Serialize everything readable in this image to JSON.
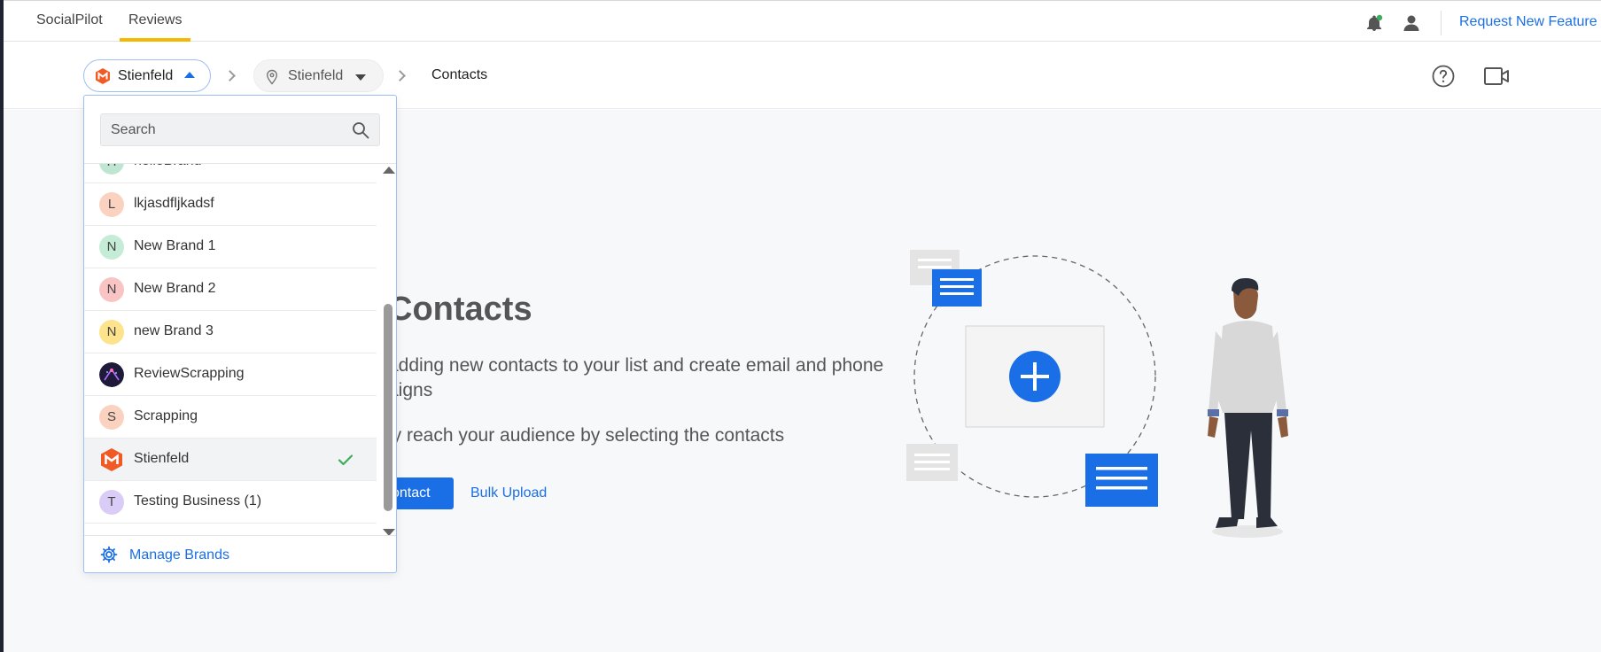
{
  "nav": {
    "tabs": [
      {
        "label": "SocialPilot"
      },
      {
        "label": "Reviews"
      }
    ],
    "request_feature": "Request New Feature"
  },
  "breadcrumb": {
    "brand": "Stienfeld",
    "location": "Stienfeld",
    "page": "Contacts"
  },
  "dropdown": {
    "search_placeholder": "Search",
    "items": [
      {
        "initial": "H",
        "name": "helloBrand",
        "color": "#bfe6d3"
      },
      {
        "initial": "L",
        "name": "lkjasdfljkadsf",
        "color": "#fbd2bf"
      },
      {
        "initial": "N",
        "name": "New Brand 1",
        "color": "#c4ecd6"
      },
      {
        "initial": "N",
        "name": "New Brand 2",
        "color": "#f9c4c4"
      },
      {
        "initial": "N",
        "name": "new Brand 3",
        "color": "#fde38c"
      },
      {
        "initial": "",
        "name": "ReviewScrapping",
        "color": "#1d1a3a"
      },
      {
        "initial": "S",
        "name": "Scrapping",
        "color": "#fbd2bf"
      },
      {
        "initial": "",
        "name": "Stienfeld",
        "color": "#f15a24",
        "selected": true
      },
      {
        "initial": "T",
        "name": "Testing Business (1)",
        "color": "#d9cdf7"
      }
    ],
    "manage_label": "Manage Brands"
  },
  "main": {
    "title": "Contacts",
    "desc_line1": "adding new contacts to your list and create email and phone",
    "desc_line1b": "aigns",
    "desc_line2": "ly reach your audience by selecting the contacts",
    "add_button": "ontact",
    "bulk_upload": "Bulk Upload"
  },
  "colors": {
    "accent": "#1a6fe6",
    "tab_underline": "#f5b800",
    "brand_logo": "#f15a24",
    "check": "#3cae5b"
  }
}
